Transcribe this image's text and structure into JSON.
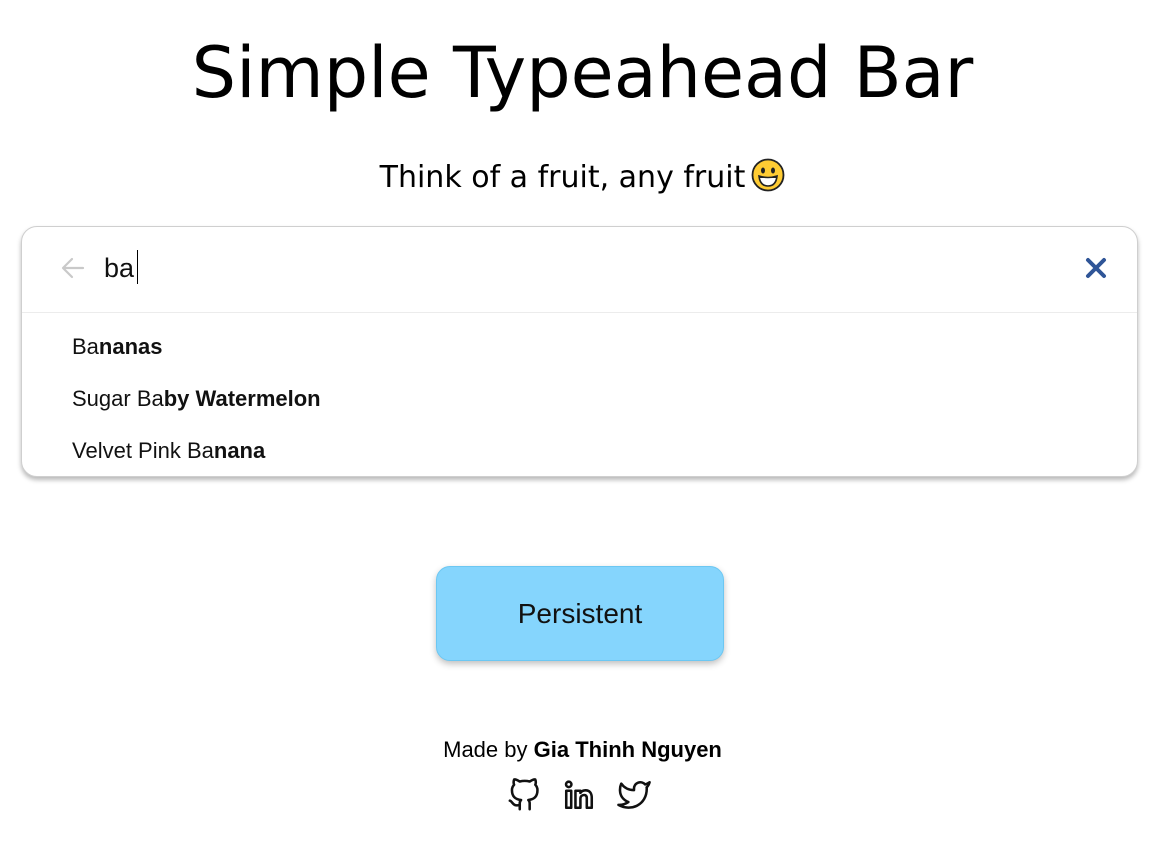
{
  "page": {
    "title": "Simple Typeahead Bar",
    "subtitle": "Think of a fruit, any fruit",
    "subtitle_emoji": "grinning-face-emoji"
  },
  "search": {
    "value": "ba",
    "back_icon": "arrow-left-icon",
    "clear_icon": "close-icon",
    "suggestions": [
      {
        "match": "Ba",
        "rest": "nanas"
      },
      {
        "match": "Sugar Ba",
        "rest": "by Watermelon"
      },
      {
        "match": "Velvet Pink Ba",
        "rest": "nana"
      }
    ]
  },
  "persist_button": {
    "label": "Persistent",
    "color": "#85d5fd"
  },
  "footer": {
    "prefix": "Made by",
    "author": "Gia Thinh Nguyen",
    "links": [
      "github-icon",
      "linkedin-icon",
      "twitter-icon"
    ]
  },
  "colors": {
    "clear_icon": "#2f5597",
    "back_icon": "#c9c9c9"
  }
}
